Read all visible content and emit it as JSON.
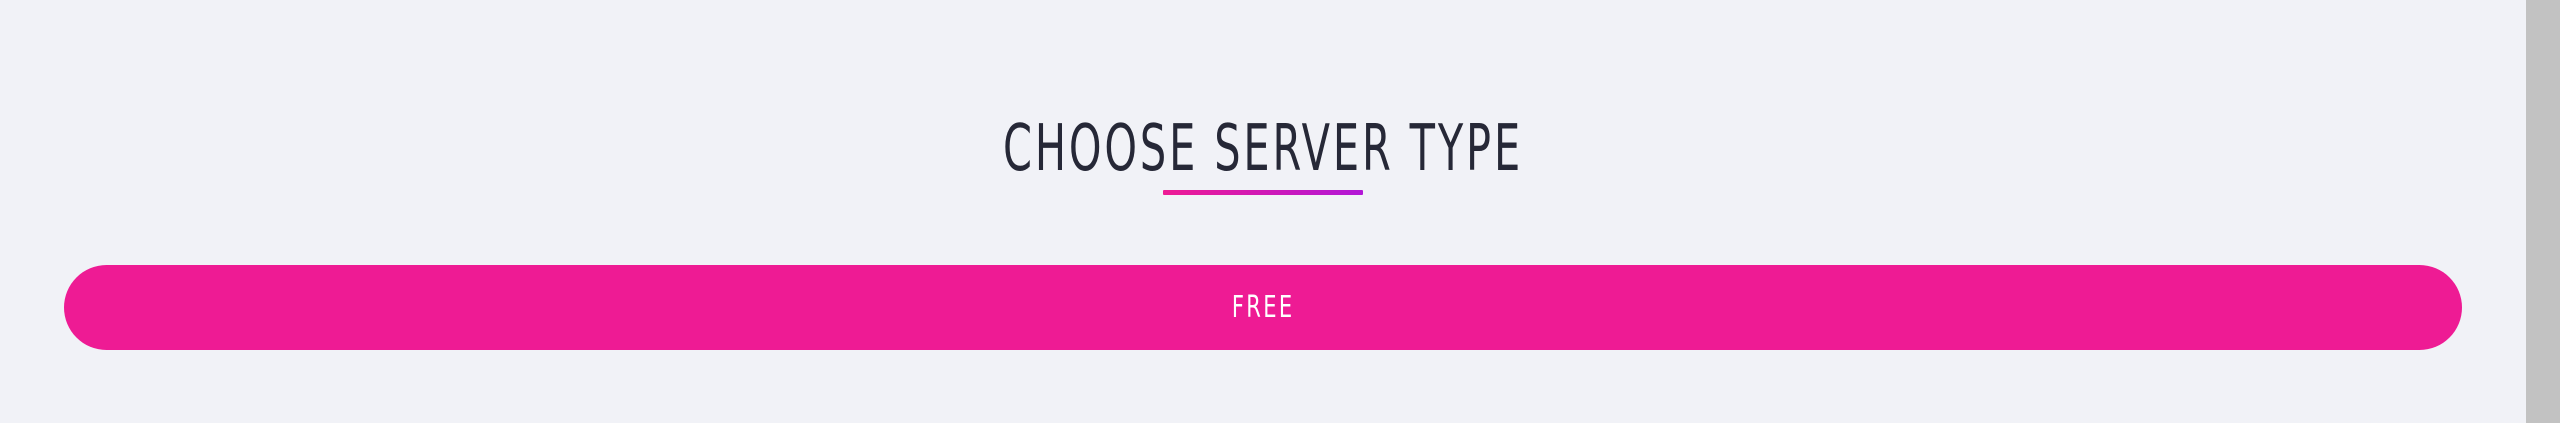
{
  "section": {
    "title": "CHOOSE SERVER TYPE"
  },
  "server_types": [
    {
      "label": "FREE"
    }
  ],
  "colors": {
    "background": "#f1f2f7",
    "accent": "#ee1b94",
    "accent_gradient_end": "#b217d7",
    "title_text": "#262837",
    "scrollbar_track": "#e5e5e5",
    "scrollbar_thumb": "#c2c2c2"
  }
}
